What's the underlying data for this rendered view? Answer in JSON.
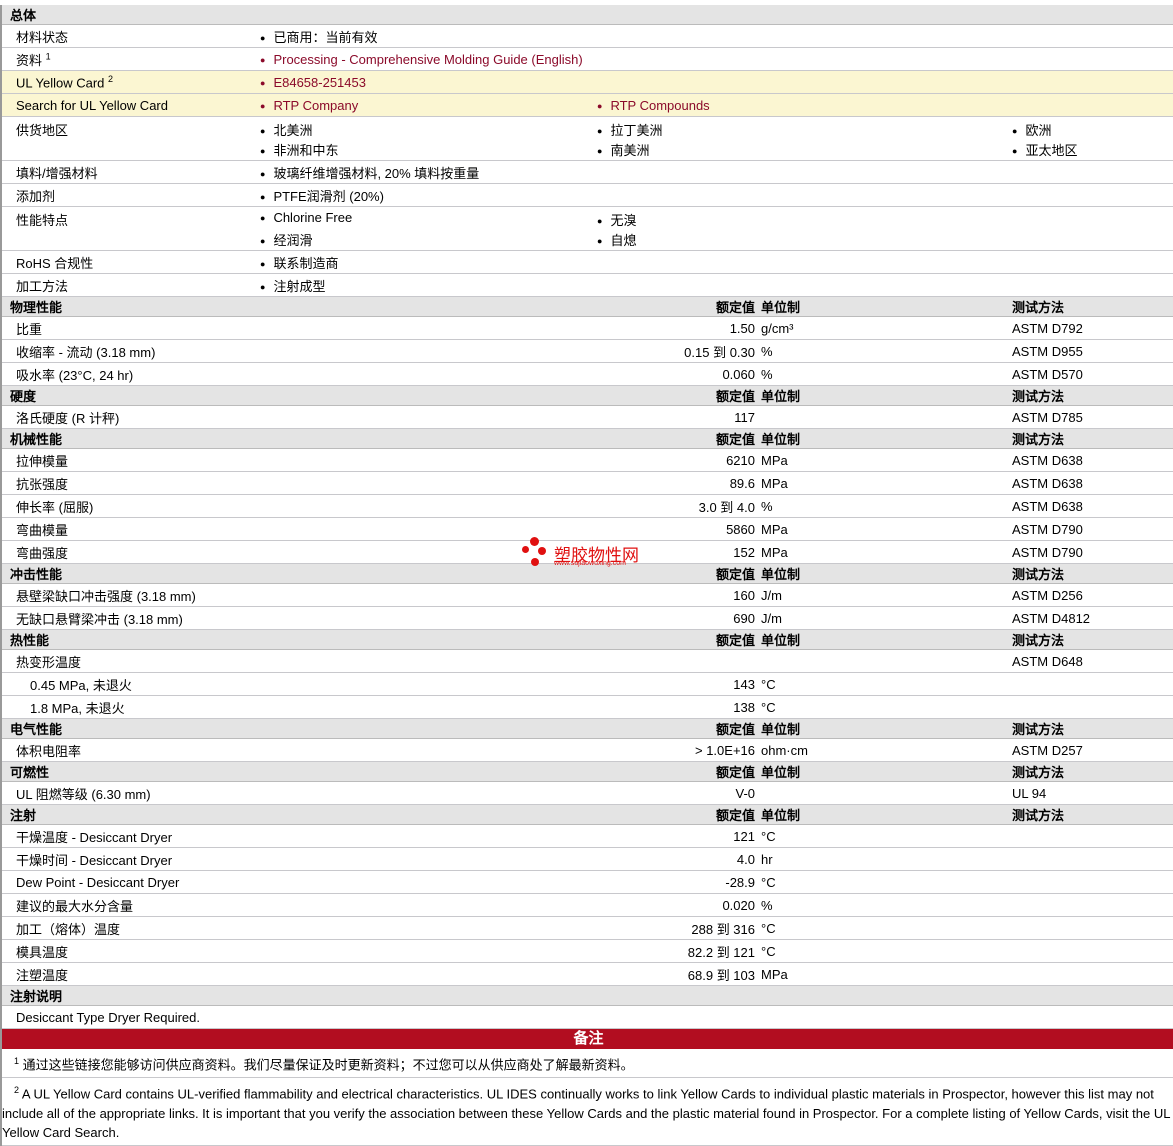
{
  "general": {
    "title": "总体",
    "rows": [
      {
        "label": "材料状态",
        "items": [
          "已商用：当前有效"
        ]
      },
      {
        "label": "资料",
        "sup": "1",
        "items": [
          "Processing - Comprehensive Molding Guide (English)"
        ],
        "link": true
      },
      {
        "label": "UL Yellow Card",
        "sup": "2",
        "items": [
          "E84658-251453"
        ],
        "link": true,
        "yellow": true
      },
      {
        "label": "Search for UL Yellow Card",
        "items": [
          "RTP Company",
          "RTP Compounds"
        ],
        "link": true,
        "yellow": true
      },
      {
        "label": "供货地区",
        "cols": [
          [
            "北美洲",
            "非洲和中东"
          ],
          [
            "拉丁美洲",
            "南美洲"
          ],
          [
            "欧洲",
            "亚太地区"
          ]
        ]
      },
      {
        "label": "填料/增强材料",
        "items": [
          "玻璃纤维增强材料, 20% 填料按重量"
        ]
      },
      {
        "label": "添加剂",
        "items": [
          "PTFE润滑剂 (20%)"
        ]
      },
      {
        "label": "性能特点",
        "cols": [
          [
            "Chlorine Free",
            "经润滑"
          ],
          [
            "无溴",
            "自熄"
          ]
        ]
      },
      {
        "label": "RoHS 合规性",
        "items": [
          "联系制造商"
        ]
      },
      {
        "label": "加工方法",
        "items": [
          "注射成型"
        ]
      }
    ]
  },
  "col_headers": {
    "value": "额定值",
    "unit": "单位制",
    "method": "测试方法"
  },
  "sections": [
    {
      "title": "物理性能",
      "method": true,
      "rows": [
        {
          "label": "比重",
          "value": "1.50",
          "unit": "g/cm³",
          "method": "ASTM D792"
        },
        {
          "label": "收缩率  - 流动 (3.18 mm)",
          "value": "0.15 到  0.30",
          "unit": "%",
          "method": "ASTM D955"
        },
        {
          "label": "吸水率 (23°C, 24 hr)",
          "value": "0.060",
          "unit": "%",
          "method": "ASTM D570"
        }
      ]
    },
    {
      "title": "硬度",
      "method": true,
      "rows": [
        {
          "label": "洛氏硬度 (R 计秤)",
          "value": "117",
          "unit": "",
          "method": "ASTM D785"
        }
      ]
    },
    {
      "title": "机械性能",
      "method": true,
      "rows": [
        {
          "label": "拉伸模量",
          "value": "6210",
          "unit": "MPa",
          "method": "ASTM D638"
        },
        {
          "label": "抗张强度",
          "value": "89.6",
          "unit": "MPa",
          "method": "ASTM D638"
        },
        {
          "label": "伸长率 (屈服)",
          "value": "3.0 到  4.0",
          "unit": "%",
          "method": "ASTM D638"
        },
        {
          "label": "弯曲模量",
          "value": "5860",
          "unit": "MPa",
          "method": "ASTM D790"
        },
        {
          "label": "弯曲强度",
          "value": "152",
          "unit": "MPa",
          "method": "ASTM D790"
        }
      ]
    },
    {
      "title": "冲击性能",
      "method": true,
      "rows": [
        {
          "label": "悬壁梁缺口冲击强度 (3.18 mm)",
          "value": "160",
          "unit": "J/m",
          "method": "ASTM D256"
        },
        {
          "label": "无缺口悬臂梁冲击 (3.18 mm)",
          "value": "690",
          "unit": "J/m",
          "method": "ASTM D4812"
        }
      ]
    },
    {
      "title": "热性能",
      "method": true,
      "rows": [
        {
          "label": "热变形温度",
          "value": "",
          "unit": "",
          "method": "ASTM D648"
        },
        {
          "label": "0.45 MPa, 未退火",
          "value": "143",
          "unit": "°C",
          "method": "",
          "indent": true
        },
        {
          "label": "1.8 MPa, 未退火",
          "value": "138",
          "unit": "°C",
          "method": "",
          "indent": true
        }
      ]
    },
    {
      "title": "电气性能",
      "method": true,
      "rows": [
        {
          "label": "体积电阻率",
          "value": "> 1.0E+16",
          "unit": "ohm·cm",
          "method": "ASTM D257"
        }
      ]
    },
    {
      "title": "可燃性",
      "method": true,
      "rows": [
        {
          "label": "UL 阻燃等级 (6.30 mm)",
          "value": "V-0",
          "unit": "",
          "method": "UL 94"
        }
      ]
    },
    {
      "title": "注射",
      "method": false,
      "rows": [
        {
          "label": "干燥温度  - Desiccant Dryer",
          "value": "121",
          "unit": "°C",
          "method": ""
        },
        {
          "label": "干燥时间  - Desiccant Dryer",
          "value": "4.0",
          "unit": "hr",
          "method": ""
        },
        {
          "label": "Dew Point - Desiccant Dryer",
          "value": "-28.9",
          "unit": "°C",
          "method": ""
        },
        {
          "label": "建议的最大水分含量",
          "value": "0.020",
          "unit": "%",
          "method": ""
        },
        {
          "label": "加工（熔体）温度",
          "value": "288 到  316",
          "unit": "°C",
          "method": ""
        },
        {
          "label": "模具温度",
          "value": "82.2 到  121",
          "unit": "°C",
          "method": ""
        },
        {
          "label": "注塑温度",
          "value": "68.9 到  103",
          "unit": "MPa",
          "method": ""
        }
      ]
    }
  ],
  "injection_notes": {
    "title": "注射说明",
    "text": "Desiccant Type Dryer Required."
  },
  "notes": {
    "title": "备注",
    "items": [
      {
        "sup": "1",
        "text": "通过这些链接您能够访问供应商资料。我们尽量保证及时更新资料；不过您可以从供应商处了解最新资料。"
      },
      {
        "sup": "2",
        "text": "A UL Yellow Card contains UL-verified flammability and electrical characteristics. UL IDES continually works to link Yellow Cards to individual plastic materials in Prospector, however this list may not include all of the appropriate links. It is important that you verify the association between these Yellow Cards and the plastic material found in Prospector. For a complete listing of Yellow Cards, visit the UL Yellow Card Search."
      }
    ]
  },
  "watermark": {
    "name": "塑胶物性网",
    "url": "www.sujiaowuxing.com",
    "color": "#e01010"
  }
}
